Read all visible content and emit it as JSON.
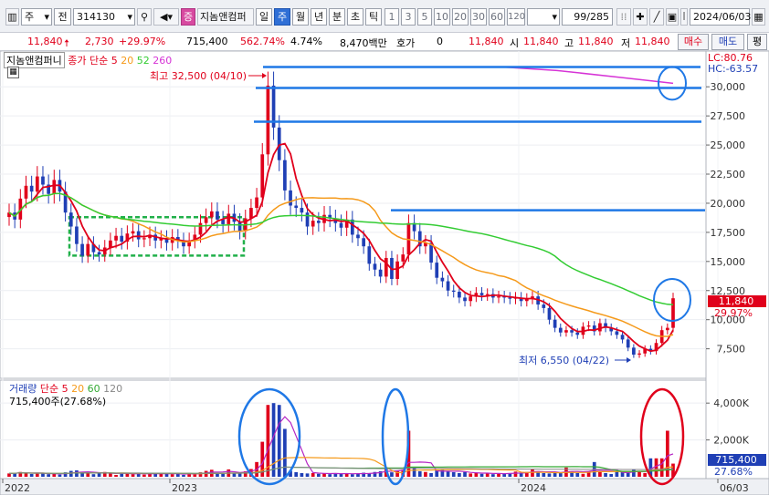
{
  "toolbar": {
    "period": "주",
    "adj": "전",
    "code": "314130",
    "company_badge": "증",
    "company": "지놈앤컴퍼",
    "periods": [
      "일",
      "주",
      "월",
      "년",
      "분",
      "초",
      "틱"
    ],
    "active_period": "주",
    "intervals": [
      "1",
      "3",
      "5",
      "10",
      "20",
      "30",
      "60",
      "120"
    ],
    "count": "99/285",
    "date": "2024/06/03"
  },
  "quote": {
    "price": "11,840",
    "change": "2,730",
    "change_pct": "+29.97%",
    "volume": "715,400",
    "vol_ratio": "562.74%",
    "turnover": "4.74%",
    "amount": "8,470백만",
    "hoga_label": "호가",
    "hoga_value": "0",
    "ask_price": "11,840",
    "open_label": "시",
    "open": "11,840",
    "high_label": "고",
    "high": "11,840",
    "low_label": "저",
    "low": "11,840",
    "buy_label": "매수",
    "sell_label": "매도",
    "eval_label": "평"
  },
  "price_panel": {
    "name": "지놈앤컴퍼니",
    "indicator": "종가 단순",
    "ma_periods": [
      "5",
      "20",
      "52",
      "260"
    ],
    "ma_colors": [
      "#e0001b",
      "#f59a1b",
      "#33cc33",
      "#d633d6"
    ],
    "lc_label": "LC:80.76",
    "hc_label": "HC:-63.57",
    "high_note": "최고 32,500 (04/10)",
    "low_note": "최저 6,550 (04/22)",
    "current_price": "11,840",
    "current_pct": "29.97%"
  },
  "volume_panel": {
    "name": "거래량",
    "indicator": "단순",
    "ma_periods": [
      "5",
      "20",
      "60",
      "120"
    ],
    "ma_colors": [
      "#e0001b",
      "#f59a1b",
      "#33aa33",
      "#888888"
    ],
    "volume_note": "715,400주(27.68%)",
    "current_volume": "715,400",
    "current_pct": "27.68%"
  },
  "x_axis": [
    "2022",
    "2023",
    "2024",
    "06/03"
  ],
  "chart_data": {
    "type": "candlestick",
    "price_axis": {
      "ticks": [
        "30,000",
        "27,500",
        "25,000",
        "22,500",
        "20,000",
        "17,500",
        "15,000",
        "12,500",
        "10,000",
        "7,500"
      ],
      "tick_values": [
        30000,
        27500,
        25000,
        22500,
        20000,
        17500,
        15000,
        12500,
        10000,
        7500
      ],
      "ylim": [
        5200,
        32600
      ]
    },
    "volume_axis": {
      "ticks": [
        "4,000K",
        "2,000K"
      ],
      "tick_values": [
        4000,
        2000
      ],
      "ylim": [
        0,
        4900
      ]
    },
    "close": [
      19200,
      18600,
      20400,
      21500,
      21000,
      22300,
      21600,
      20800,
      22000,
      21000,
      19200,
      18000,
      16500,
      15500,
      16500,
      15800,
      15600,
      16200,
      16800,
      17200,
      16700,
      17400,
      17600,
      16900,
      17000,
      17300,
      16800,
      17000,
      16600,
      17100,
      16800,
      16300,
      16800,
      17300,
      18300,
      18800,
      19300,
      18600,
      18200,
      19100,
      18400,
      17600,
      18700,
      19600,
      20500,
      24200,
      30100,
      26500,
      23700,
      21100,
      19800,
      19600,
      19200,
      18000,
      18500,
      18300,
      19000,
      18700,
      18300,
      17900,
      18600,
      17300,
      17000,
      16300,
      14800,
      14300,
      13700,
      15300,
      13500,
      15000,
      15600,
      18300,
      17600,
      16300,
      16600,
      14900,
      13600,
      13300,
      12500,
      12400,
      11900,
      11600,
      12000,
      12300,
      12100,
      12200,
      11900,
      12000,
      11900,
      11800,
      11900,
      11600,
      11800,
      12000,
      11300,
      11000,
      10000,
      9300,
      8900,
      9100,
      8900,
      8700,
      9400,
      9500,
      9000,
      9700,
      9300,
      9000,
      8700,
      8300,
      7600,
      7000,
      7100,
      7500,
      7300,
      8000,
      9100,
      9300,
      11840
    ],
    "volume": [
      180,
      200,
      260,
      200,
      150,
      200,
      180,
      140,
      160,
      120,
      240,
      320,
      350,
      220,
      200,
      140,
      200,
      260,
      180,
      100,
      200,
      180,
      140,
      200,
      120,
      160,
      200,
      150,
      180,
      140,
      160,
      100,
      200,
      150,
      240,
      320,
      380,
      200,
      160,
      400,
      220,
      180,
      300,
      420,
      800,
      1900,
      3900,
      4000,
      3900,
      2600,
      320,
      250,
      200,
      180,
      200,
      160,
      180,
      140,
      200,
      160,
      180,
      140,
      160,
      220,
      200,
      260,
      300,
      500,
      240,
      300,
      380,
      2500,
      500,
      300,
      260,
      200,
      350,
      400,
      300,
      250,
      200,
      260,
      180,
      200,
      160,
      200,
      140,
      180,
      160,
      200,
      280,
      200,
      260,
      400,
      300,
      200,
      180,
      250,
      200,
      500,
      300,
      200,
      160,
      300,
      800,
      300,
      200,
      150,
      300,
      260,
      200,
      400,
      300,
      200,
      1000,
      1000,
      1000,
      2500,
      715
    ]
  }
}
